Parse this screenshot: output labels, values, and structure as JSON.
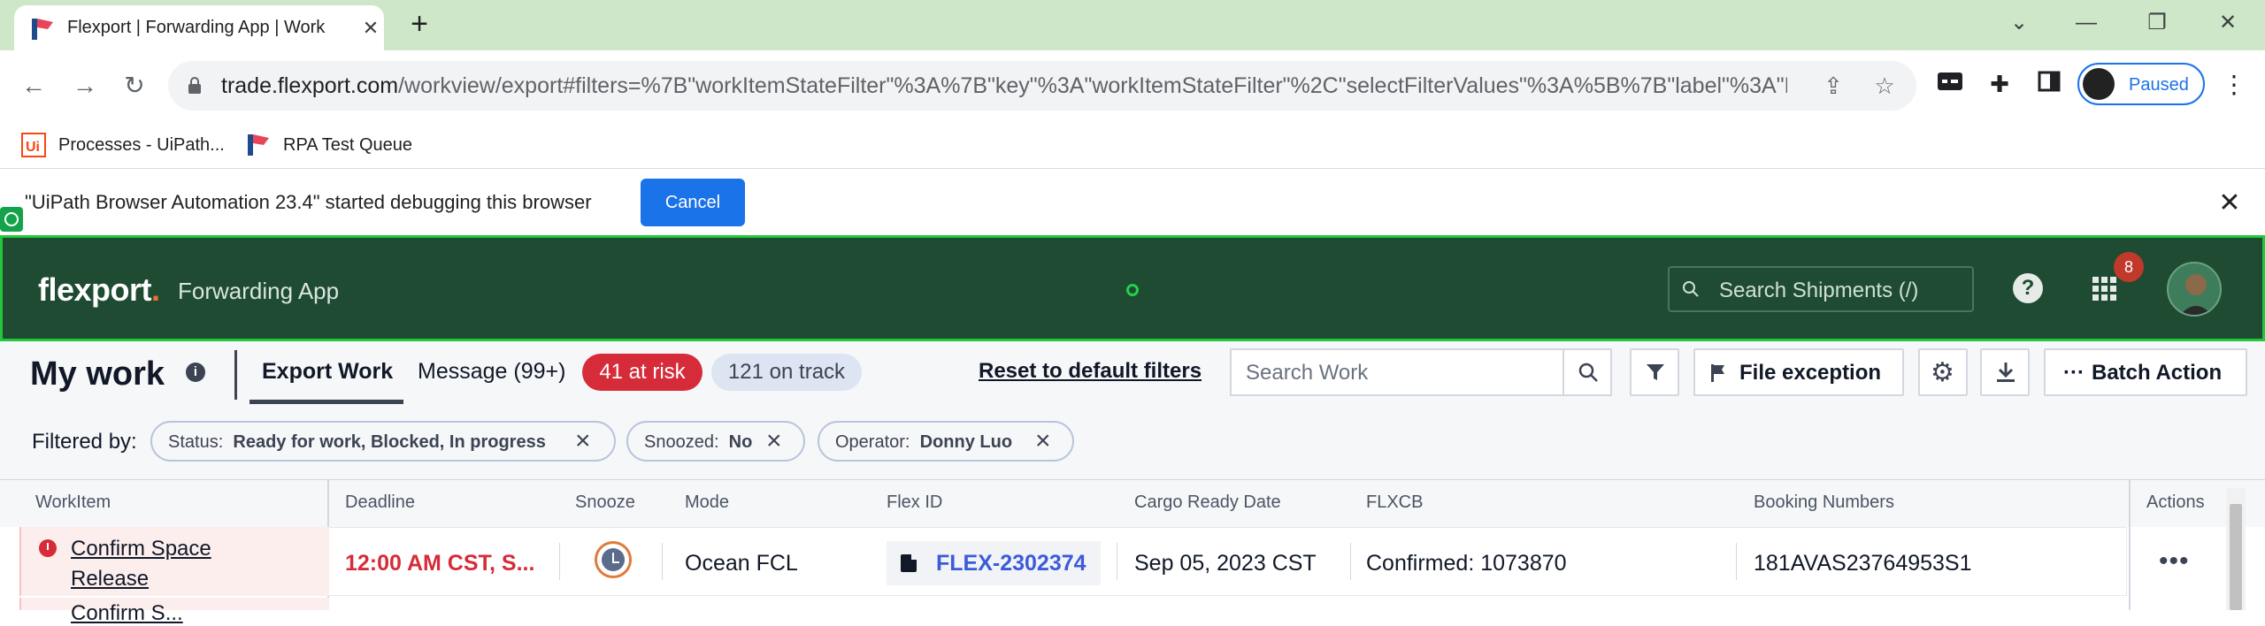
{
  "browser": {
    "tab_title": "Flexport | Forwarding App | Work",
    "url_host": "trade.flexport.com",
    "url_path": "/workview/export#filters=%7B\"workItemStateFilter\"%3A%7B\"key\"%3A\"workItemStateFilter\"%2C\"selectFilterValues\"%3A%5B%7B\"label\"%3A\"Ready+f...",
    "profile_label": "Paused",
    "bookmarks": [
      {
        "label": "Processes - UiPath..."
      },
      {
        "label": "RPA Test Queue"
      }
    ],
    "infobar_message": "\"UiPath Browser Automation 23.4\" started debugging this browser",
    "infobar_button": "Cancel"
  },
  "app": {
    "logo": "flexport",
    "logo_dot": ".",
    "subtitle": "Forwarding App",
    "search_placeholder": "Search Shipments (/)",
    "help_glyph": "?",
    "notification_count": "8"
  },
  "work": {
    "title": "My work",
    "tabs": [
      {
        "label": "Export Work",
        "active": true
      },
      {
        "label": "Message (99+)",
        "active": false
      }
    ],
    "at_risk": "41 at risk",
    "on_track": "121 on track",
    "reset_label": "Reset to default filters",
    "search_placeholder": "Search Work",
    "file_exception_label": "File exception",
    "batch_action_label": "Batch Action",
    "filtered_by_label": "Filtered by:",
    "filters": [
      {
        "key": "Status:",
        "value": "Ready for work, Blocked, In progress"
      },
      {
        "key": "Snoozed:",
        "value": "No"
      },
      {
        "key": "Operator:",
        "value": "Donny Luo"
      }
    ]
  },
  "table": {
    "columns": [
      "WorkItem",
      "Deadline",
      "Snooze",
      "Mode",
      "Flex ID",
      "Cargo Ready Date",
      "FLXCB",
      "Booking Numbers",
      "Actions"
    ],
    "rows": [
      {
        "workitem": "Confirm Space Release",
        "deadline": "12:00 AM CST, S...",
        "mode": "Ocean FCL",
        "flex_id": "FLEX-2302374",
        "cargo_ready_date": "Sep 05, 2023 CST",
        "flxcb": "Confirmed: 1073870",
        "booking_numbers": "181AVAS23764953S1",
        "actions": "•••"
      }
    ],
    "next_row_partial": "Confirm S..."
  },
  "colors": {
    "header_bg": "#1e4b32",
    "accent_green": "#20c83a",
    "risk_red": "#d62c3a",
    "link_blue": "#3b5bdb",
    "chrome_blue": "#1a73e8"
  }
}
